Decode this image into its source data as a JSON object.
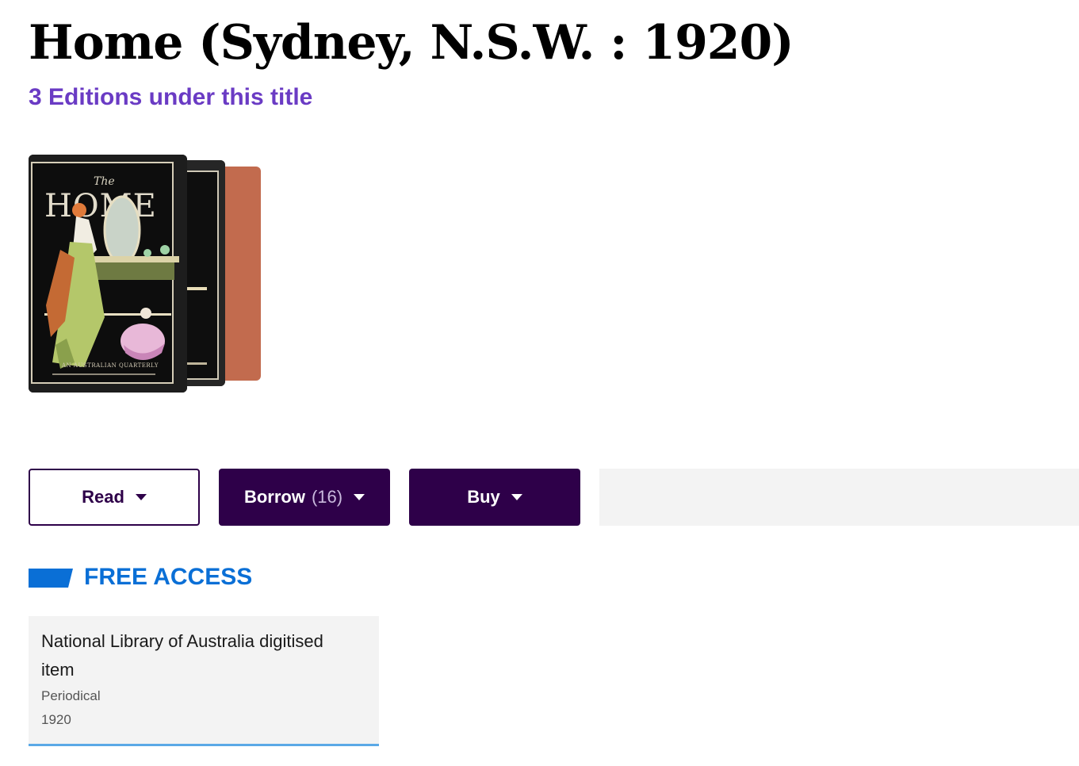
{
  "header": {
    "title": "Home (Sydney, N.S.W. : 1920)",
    "editions_link": "3 Editions under this title"
  },
  "covers": {
    "front_masthead": "HOME",
    "front_script": "The",
    "front_caption": "AN AUSTRALIAN QUARTERLY"
  },
  "actions": {
    "read_label": "Read",
    "borrow_label": "Borrow",
    "borrow_count": "(16)",
    "buy_label": "Buy"
  },
  "free_access": {
    "heading": "FREE ACCESS",
    "items": [
      {
        "title": "National Library of Australia digitised item",
        "type": "Periodical",
        "year": "1920"
      }
    ]
  },
  "colors": {
    "accent_purple": "#6a3bc4",
    "button_dark": "#2e0049",
    "free_access_blue": "#0a6fd6",
    "card_underline": "#5aa9e6"
  }
}
